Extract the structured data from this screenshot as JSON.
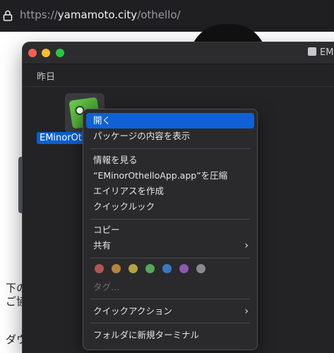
{
  "browser": {
    "url_scheme": "https://",
    "url_host": "yamamoto.city",
    "url_path": "/othello/"
  },
  "webpage": {
    "text_lines": [
      "下の",
      "ご協",
      "ダウ"
    ]
  },
  "finder": {
    "window_title": "EM",
    "section_title": "昨日",
    "file_label": "EMinorOth"
  },
  "context_menu": {
    "open": "開く",
    "show_package": "パッケージの内容を表示",
    "get_info": "情報を見る",
    "compress": "“EMinorOthelloApp.app”を圧縮",
    "make_alias": "エイリアスを作成",
    "quick_look": "クイックルック",
    "copy": "コピー",
    "share": "共有",
    "tags_placeholder": "タグ…",
    "quick_actions": "クイックアクション",
    "new_terminal": "フォルダに新規ターミナル",
    "tag_colors": [
      {
        "name": "red",
        "hex": "#b3544f"
      },
      {
        "name": "orange",
        "hex": "#b7843e"
      },
      {
        "name": "yellow",
        "hex": "#b2a43f"
      },
      {
        "name": "green",
        "hex": "#58a55c"
      },
      {
        "name": "blue",
        "hex": "#3b78c2"
      },
      {
        "name": "purple",
        "hex": "#8e58b3"
      },
      {
        "name": "gray",
        "hex": "#8a8a8d"
      }
    ]
  },
  "colors": {
    "selection_blue": "#1060d6",
    "menu_bg": "#2a2a2c"
  }
}
